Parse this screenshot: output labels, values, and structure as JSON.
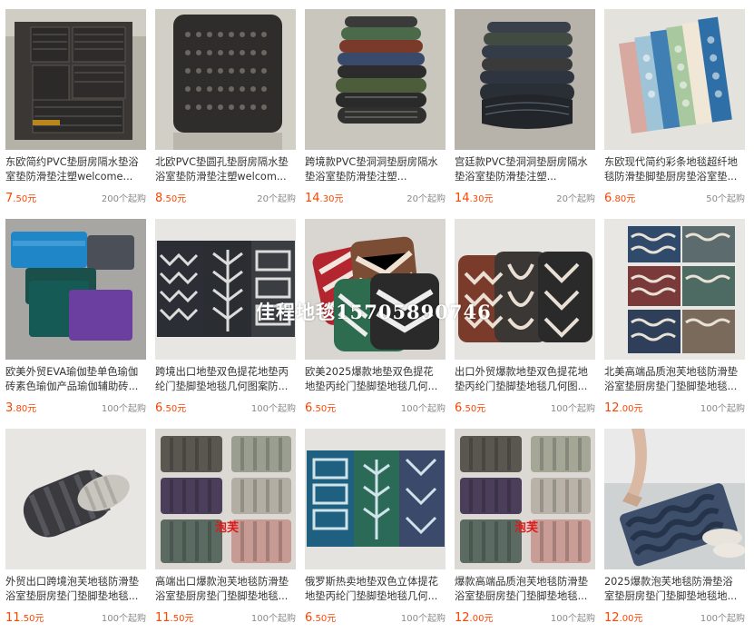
{
  "products": [
    {
      "title": "东欧简约PVC垫厨房隔水垫浴室垫防滑垫注塑welcome...",
      "price_int": "7",
      "price_dec": ".50",
      "unit": "元",
      "moq": "200个起购"
    },
    {
      "title": "北欧PVC垫圆孔垫厨房隔水垫浴室垫防滑垫注塑welcom...",
      "price_int": "8",
      "price_dec": ".50",
      "unit": "元",
      "moq": "20个起购"
    },
    {
      "title": "跨境款PVC垫洞洞垫厨房隔水垫浴室垫防滑垫注塑...",
      "price_int": "14",
      "price_dec": ".30",
      "unit": "元",
      "moq": "20个起购"
    },
    {
      "title": "宫廷款PVC垫洞洞垫厨房隔水垫浴室垫防滑垫注塑...",
      "price_int": "14",
      "price_dec": ".30",
      "unit": "元",
      "moq": "20个起购"
    },
    {
      "title": "东欧现代简约彩条地毯超纤地毯防滑垫脚垫厨房垫浴室垫...",
      "price_int": "6",
      "price_dec": ".80",
      "unit": "元",
      "moq": "50个起购"
    },
    {
      "title": "欧美外贸EVA瑜伽垫单色瑜伽砖素色瑜伽产品瑜伽辅助砖...",
      "price_int": "3",
      "price_dec": ".80",
      "unit": "元",
      "moq": "100个起购"
    },
    {
      "title": "跨境出口地垫双色提花地垫丙纶门垫脚垫地毯几何图案防...",
      "price_int": "6",
      "price_dec": ".50",
      "unit": "元",
      "moq": "100个起购"
    },
    {
      "title": "欧美2025爆款地垫双色提花地垫丙纶门垫脚垫地毯几何...",
      "price_int": "6",
      "price_dec": ".50",
      "unit": "元",
      "moq": "100个起购"
    },
    {
      "title": "出口外贸爆款地垫双色提花地垫丙纶门垫脚垫地毯几何图...",
      "price_int": "6",
      "price_dec": ".50",
      "unit": "元",
      "moq": "100个起购"
    },
    {
      "title": "北美高端品质泡芙地毯防滑垫浴室垫厨房垫门垫脚垫地毯...",
      "price_int": "12",
      "price_dec": ".00",
      "unit": "元",
      "moq": "100个起购"
    },
    {
      "title": "外贸出口跨境泡芙地毯防滑垫浴室垫厨房垫门垫脚垫地毯...",
      "price_int": "11",
      "price_dec": ".50",
      "unit": "元",
      "moq": "100个起购"
    },
    {
      "title": "高端出口爆款泡芙地毯防滑垫浴室垫厨房垫门垫脚垫地毯...",
      "price_int": "11",
      "price_dec": ".50",
      "unit": "元",
      "moq": "100个起购"
    },
    {
      "title": "俄罗斯热卖地垫双色立体提花地垫丙纶门垫脚垫地毯几何...",
      "price_int": "6",
      "price_dec": ".50",
      "unit": "元",
      "moq": "100个起购"
    },
    {
      "title": "爆款高端品质泡芙地毯防滑垫浴室垫厨房垫门垫脚垫地毯...",
      "price_int": "12",
      "price_dec": ".00",
      "unit": "元",
      "moq": "100个起购"
    },
    {
      "title": "2025爆款泡芙地毯防滑垫浴室垫厨房垫门垫脚垫地毯地...",
      "price_int": "12",
      "price_dec": ".00",
      "unit": "元",
      "moq": "100个起购"
    }
  ],
  "overlay_text": "佳程地毯15705890746",
  "watermarks": {
    "card12": "泡芙",
    "card14": "泡芙"
  },
  "colors": {
    "price": "#ff4400",
    "title": "#333333",
    "moq": "#888888",
    "watermark": "#e01818"
  }
}
